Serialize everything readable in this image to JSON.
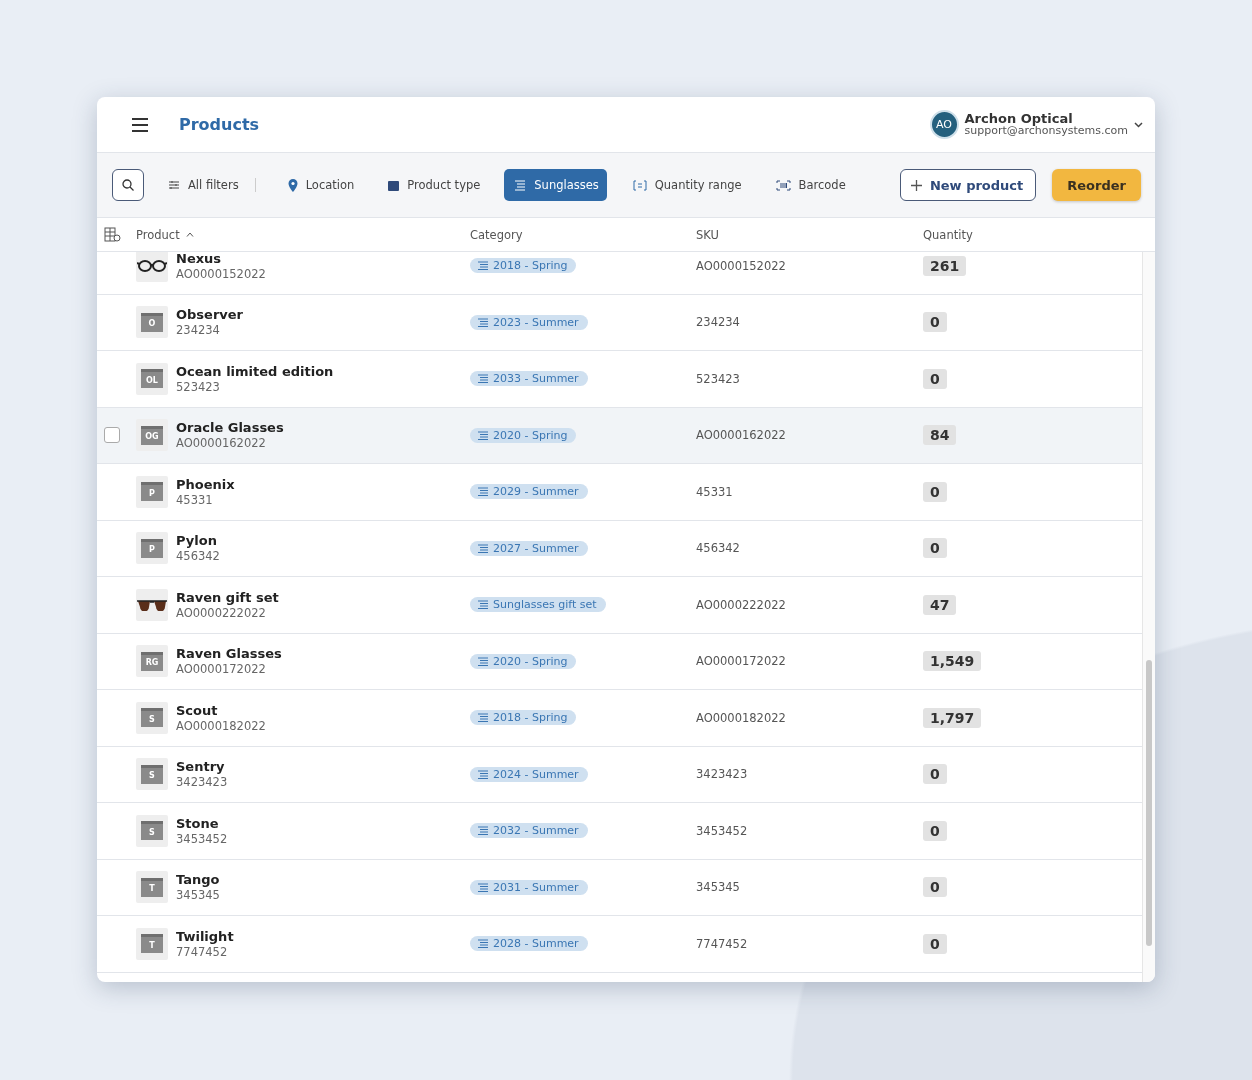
{
  "header": {
    "title": "Products",
    "account": {
      "initials": "AO",
      "name": "Archon Optical",
      "email": "support@archonsystems.com"
    }
  },
  "filters": [
    {
      "label": "All filters",
      "kind": "sliders",
      "selected": false
    },
    {
      "label": "Location",
      "kind": "pin",
      "selected": false
    },
    {
      "label": "Product type",
      "kind": "box",
      "selected": false
    },
    {
      "label": "Sunglasses",
      "kind": "lines",
      "selected": true
    },
    {
      "label": "Quantity range",
      "kind": "range",
      "selected": false
    },
    {
      "label": "Barcode",
      "kind": "barcode",
      "selected": false
    }
  ],
  "actions": {
    "new": "New product",
    "reorder": "Reorder"
  },
  "table": {
    "columns": [
      {
        "label": "Product",
        "sorted": true
      },
      {
        "label": "Category",
        "sorted": false
      },
      {
        "label": "SKU",
        "sorted": false
      },
      {
        "label": "Quantity",
        "sorted": false
      }
    ],
    "rows": [
      {
        "name": "Nexus",
        "code": "AO0000152022",
        "thumb": {
          "kind": "eyeglasses"
        },
        "category": "2018 - Spring",
        "sku": "AO0000152022",
        "quantity": "261",
        "hovered": false
      },
      {
        "name": "Observer",
        "code": "234234",
        "thumb": {
          "kind": "initials",
          "text": "O"
        },
        "category": "2023 - Summer",
        "sku": "234234",
        "quantity": "0",
        "hovered": false
      },
      {
        "name": "Ocean limited edition",
        "code": "523423",
        "thumb": {
          "kind": "initials",
          "text": "OL"
        },
        "category": "2033 - Summer",
        "sku": "523423",
        "quantity": "0",
        "hovered": false
      },
      {
        "name": "Oracle Glasses",
        "code": "AO0000162022",
        "thumb": {
          "kind": "initials",
          "text": "OG"
        },
        "category": "2020 - Spring",
        "sku": "AO0000162022",
        "quantity": "84",
        "hovered": true
      },
      {
        "name": "Phoenix",
        "code": "45331",
        "thumb": {
          "kind": "initials",
          "text": "P"
        },
        "category": "2029 - Summer",
        "sku": "45331",
        "quantity": "0",
        "hovered": false
      },
      {
        "name": "Pylon",
        "code": "456342",
        "thumb": {
          "kind": "initials",
          "text": "P"
        },
        "category": "2027 - Summer",
        "sku": "456342",
        "quantity": "0",
        "hovered": false
      },
      {
        "name": "Raven gift set",
        "code": "AO0000222022",
        "thumb": {
          "kind": "sunglasses"
        },
        "category": "Sunglasses gift set",
        "sku": "AO0000222022",
        "quantity": "47",
        "hovered": false
      },
      {
        "name": "Raven Glasses",
        "code": "AO0000172022",
        "thumb": {
          "kind": "initials",
          "text": "RG"
        },
        "category": "2020 - Spring",
        "sku": "AO0000172022",
        "quantity": "1,549",
        "hovered": false
      },
      {
        "name": "Scout",
        "code": "AO0000182022",
        "thumb": {
          "kind": "initials",
          "text": "S"
        },
        "category": "2018 - Spring",
        "sku": "AO0000182022",
        "quantity": "1,797",
        "hovered": false
      },
      {
        "name": "Sentry",
        "code": "3423423",
        "thumb": {
          "kind": "initials",
          "text": "S"
        },
        "category": "2024 - Summer",
        "sku": "3423423",
        "quantity": "0",
        "hovered": false
      },
      {
        "name": "Stone",
        "code": "3453452",
        "thumb": {
          "kind": "initials",
          "text": "S"
        },
        "category": "2032 - Summer",
        "sku": "3453452",
        "quantity": "0",
        "hovered": false
      },
      {
        "name": "Tango",
        "code": "345345",
        "thumb": {
          "kind": "initials",
          "text": "T"
        },
        "category": "2031 - Summer",
        "sku": "345345",
        "quantity": "0",
        "hovered": false
      },
      {
        "name": "Twilight",
        "code": "7747452",
        "thumb": {
          "kind": "initials",
          "text": "T"
        },
        "category": "2028 - Summer",
        "sku": "7747452",
        "quantity": "0",
        "hovered": false
      }
    ]
  }
}
